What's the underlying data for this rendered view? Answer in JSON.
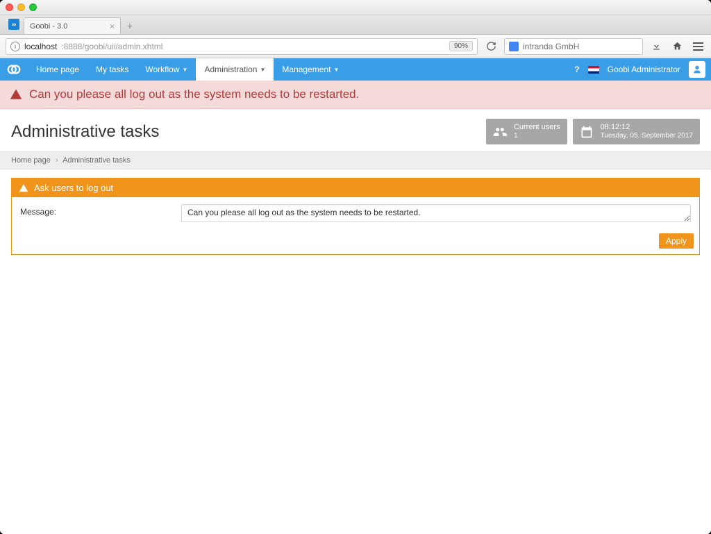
{
  "browser": {
    "tab_title": "Goobi - 3.0",
    "url_host": "localhost",
    "url_path": ":8888/goobi/uii/admin.xhtml",
    "zoom": "90%",
    "search_placeholder": "intranda GmbH"
  },
  "nav": {
    "items": [
      {
        "label": "Home page",
        "active": false,
        "caret": false
      },
      {
        "label": "My tasks",
        "active": false,
        "caret": false
      },
      {
        "label": "Workflow",
        "active": false,
        "caret": true
      },
      {
        "label": "Administration",
        "active": true,
        "caret": true
      },
      {
        "label": "Management",
        "active": false,
        "caret": true
      }
    ],
    "user_label": "Goobi Administrator"
  },
  "alert_text": "Can you please all log out as the system needs to be restarted.",
  "page_title": "Administrative tasks",
  "cards": {
    "users_label": "Current users",
    "users_count": "1",
    "time": "08:12:12",
    "date": "Tuesday, 05. September 2017"
  },
  "breadcrumb": {
    "home": "Home page",
    "current": "Administrative tasks"
  },
  "panel": {
    "title": "Ask users to log out",
    "message_label": "Message:",
    "message_value": "Can you please all log out as the system needs to be restarted.",
    "apply_label": "Apply"
  }
}
